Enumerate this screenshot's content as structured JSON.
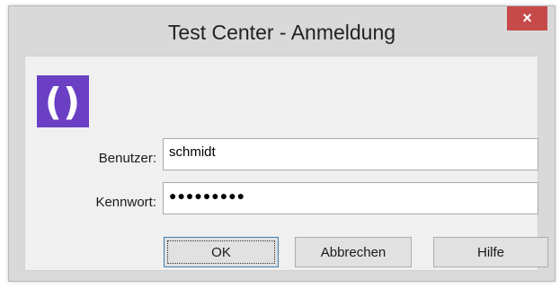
{
  "window": {
    "title": "Test Center - Anmeldung",
    "close_glyph": "×",
    "close_icon": "close-icon"
  },
  "logo": {
    "icon": "app-logo-icon",
    "glyph": "()",
    "color": "#6a3fc4"
  },
  "form": {
    "user_label": "Benutzer:",
    "user_value": "schmidt",
    "password_label": "Kennwort:",
    "password_value": "●●●●●●●●●"
  },
  "buttons": {
    "ok": "OK",
    "cancel": "Abbrechen",
    "help": "Hilfe"
  },
  "colors": {
    "close_button": "#c74a4a",
    "window_frame": "#d9d9d9",
    "client_background": "#f0f0f0"
  }
}
